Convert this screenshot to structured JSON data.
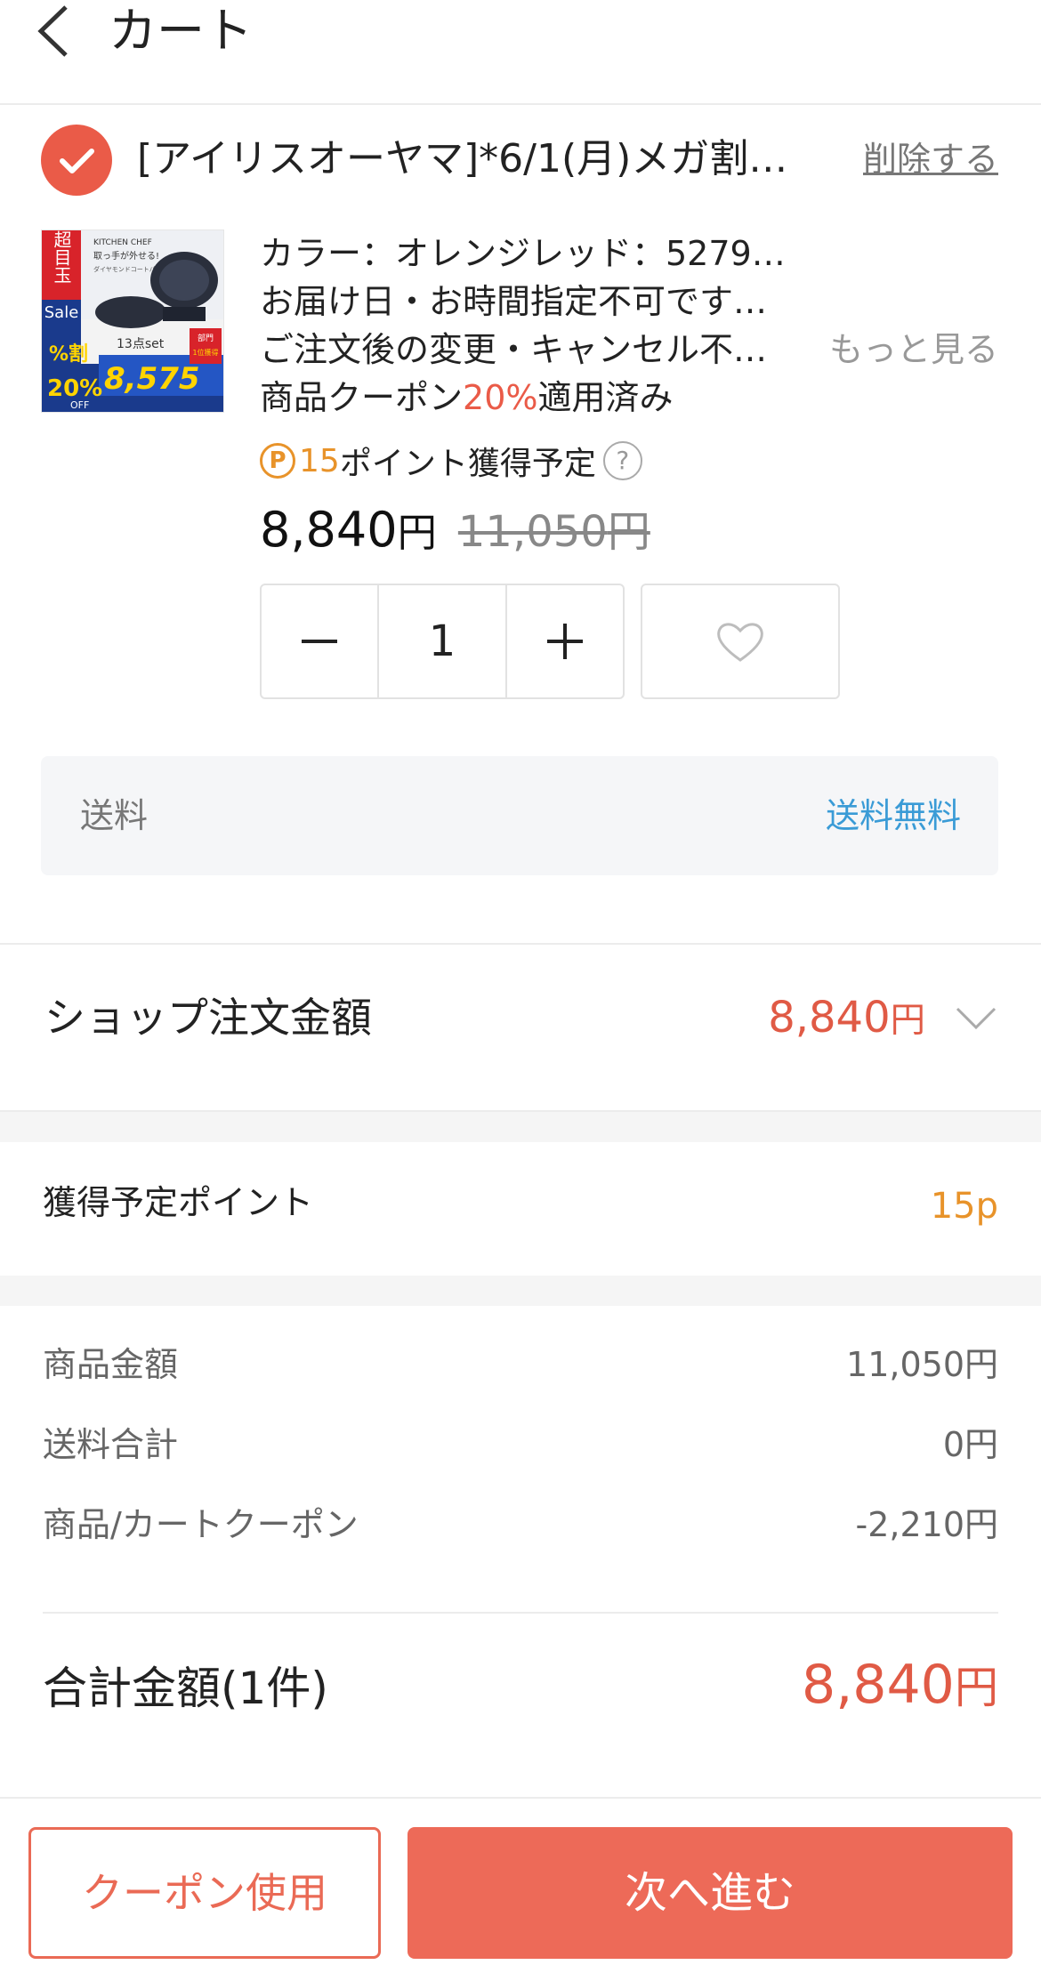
{
  "header": {
    "title": "カート",
    "back_icon": "chevron-left-icon"
  },
  "shop": {
    "name": "[アイリスオーヤマ]*6/1(月)メガ割…",
    "delete_label": "削除する",
    "checked": true
  },
  "product": {
    "image_badges": {
      "super_deal": "超目玉",
      "sale": "Sale",
      "discount": "20%",
      "off": "OFF",
      "discount_prefix": "%割",
      "set_label": "13点set",
      "price": "8,575",
      "brand": "KITCHEN CHEF",
      "headline": "取っ手が外せる!",
      "sub": "ダイヤモンドコートパン",
      "rank_title": "部門",
      "rank_text": "1位獲得"
    },
    "detail_1": "カラー：オレンジレッド：5279…",
    "detail_2": "お届け日・お時間指定不可です…",
    "detail_3": "ご注文後の変更・キャンセル不…",
    "more_label": "もっと見る",
    "coupon_prefix": "商品クーポン",
    "coupon_percent": "20%",
    "coupon_suffix": "適用済み",
    "points_symbol": "P",
    "points_value": "15",
    "points_text": "ポイント獲得予定",
    "help_symbol": "?",
    "price_value": "8,840",
    "price_unit": "円",
    "original_price_value": "11,050",
    "original_price_unit": "円",
    "quantity": "1",
    "minus_icon": "minus-icon",
    "plus_icon": "plus-icon",
    "favorite_icon": "heart-icon"
  },
  "shipping": {
    "label": "送料",
    "value": "送料無料"
  },
  "shop_order": {
    "label": "ショップ注文金額",
    "amount": "8,840",
    "unit": "円"
  },
  "points_summary": {
    "label": "獲得予定ポイント",
    "value": "15p"
  },
  "summary": [
    {
      "label": "商品金額",
      "value": "11,050円"
    },
    {
      "label": "送料合計",
      "value": "0円"
    },
    {
      "label": "商品/カートクーポン",
      "value": "-2,210円"
    }
  ],
  "total": {
    "label": "合計金額(1件)",
    "amount": "8,840",
    "unit": "円"
  },
  "actions": {
    "coupon_label": "クーポン使用",
    "next_label": "次へ進む"
  },
  "colors": {
    "accent": "#ea5b48",
    "points": "#e8932a",
    "shipping_free": "#3a9bd6",
    "next_button": "#ed6a58"
  }
}
